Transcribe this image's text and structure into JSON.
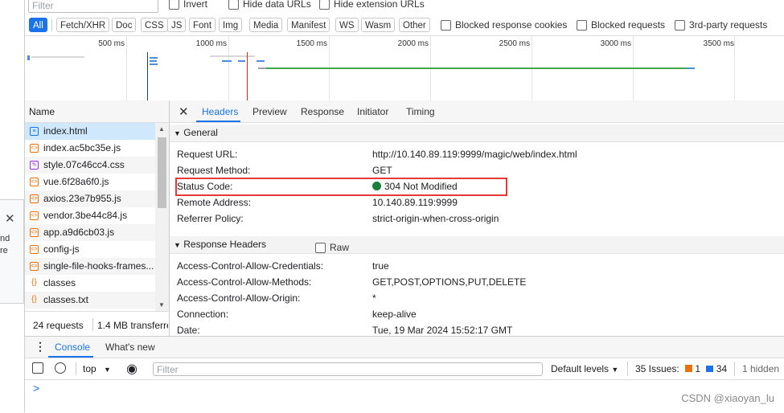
{
  "filter": {
    "placeholder": "Filter"
  },
  "checkboxes": {
    "invert": "Invert",
    "hide_data_urls": "Hide data URLs",
    "hide_extension_urls": "Hide extension URLs",
    "blocked_cookies": "Blocked response cookies",
    "blocked_requests": "Blocked requests",
    "third_party": "3rd-party requests"
  },
  "type_filters": [
    "All",
    "Fetch/XHR",
    "Doc",
    "CSS",
    "JS",
    "Font",
    "Img",
    "Media",
    "Manifest",
    "WS",
    "Wasm",
    "Other"
  ],
  "timeline": {
    "ticks": [
      "500 ms",
      "1000 ms",
      "1500 ms",
      "2000 ms",
      "2500 ms",
      "3000 ms",
      "3500 ms"
    ]
  },
  "request_list": {
    "header": "Name",
    "items": [
      {
        "name": "index.html",
        "type": "doc"
      },
      {
        "name": "index.ac5bc35e.js",
        "type": "js"
      },
      {
        "name": "style.07c46cc4.css",
        "type": "css"
      },
      {
        "name": "vue.6f28a6f0.js",
        "type": "js"
      },
      {
        "name": "axios.23e7b955.js",
        "type": "js"
      },
      {
        "name": "vendor.3be44c84.js",
        "type": "js"
      },
      {
        "name": "app.a9d6cb03.js",
        "type": "js"
      },
      {
        "name": "config-js",
        "type": "js"
      },
      {
        "name": "single-file-hooks-frames...",
        "type": "js"
      },
      {
        "name": "classes",
        "type": "xhr"
      },
      {
        "name": "classes.txt",
        "type": "xhr"
      }
    ],
    "status_requests": "24 requests",
    "status_transferred": "1.4 MB transferre"
  },
  "detail_tabs": [
    "Headers",
    "Preview",
    "Response",
    "Initiator",
    "Timing"
  ],
  "general": {
    "title": "General",
    "rows": [
      {
        "key": "Request URL:",
        "value": "http://10.140.89.119:9999/magic/web/index.html"
      },
      {
        "key": "Request Method:",
        "value": "GET"
      },
      {
        "key": "Status Code:",
        "value": "304 Not Modified"
      },
      {
        "key": "Remote Address:",
        "value": "10.140.89.119:9999"
      },
      {
        "key": "Referrer Policy:",
        "value": "strict-origin-when-cross-origin"
      }
    ]
  },
  "response_headers": {
    "title": "Response Headers",
    "raw_label": "Raw",
    "rows": [
      {
        "key": "Access-Control-Allow-Credentials:",
        "value": "true"
      },
      {
        "key": "Access-Control-Allow-Methods:",
        "value": "GET,POST,OPTIONS,PUT,DELETE"
      },
      {
        "key": "Access-Control-Allow-Origin:",
        "value": "*"
      },
      {
        "key": "Connection:",
        "value": "keep-alive"
      },
      {
        "key": "Date:",
        "value": "Tue, 19 Mar 2024 15:52:17 GMT"
      }
    ]
  },
  "drawer": {
    "tabs": [
      "Console",
      "What's new"
    ],
    "context": "top",
    "filter_placeholder": "Filter",
    "default_levels": "Default levels",
    "issues_label": "35 Issues:",
    "issues_warn": "1",
    "issues_info": "34",
    "hidden": "1 hidden",
    "prompt": ">"
  },
  "popup": {
    "line1": "nd",
    "line2": "re"
  },
  "watermark": "CSDN @xiaoyan_lu",
  "colors": {
    "accent": "#1a73e8",
    "status_ok": "#188038",
    "highlight": "#e53935"
  }
}
